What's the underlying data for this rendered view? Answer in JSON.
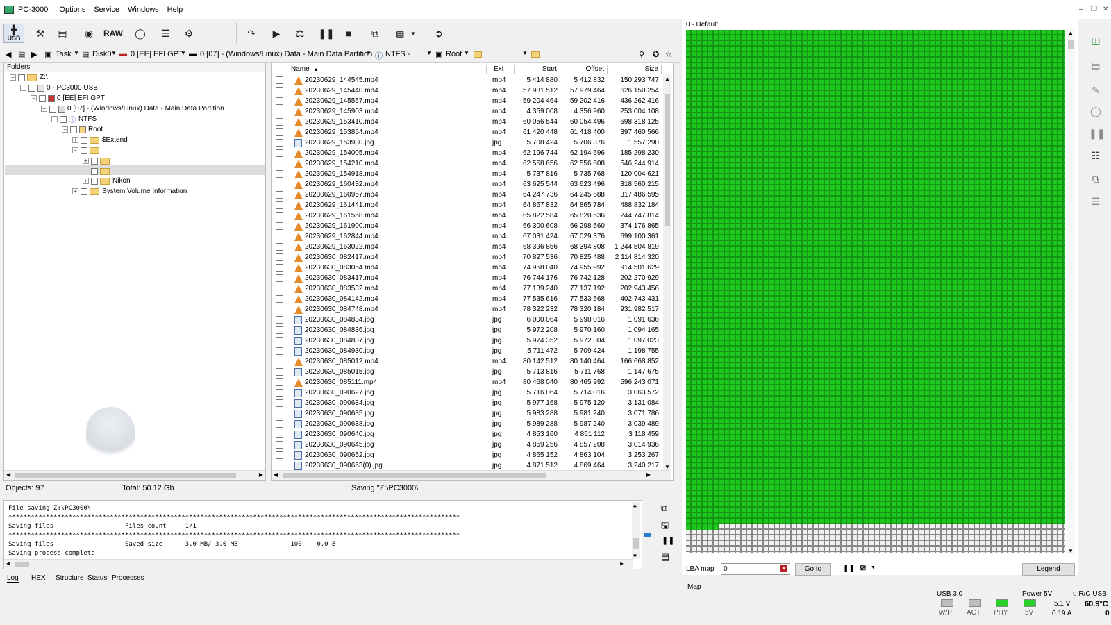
{
  "window": {
    "title": "PC-3000",
    "menu": [
      "Options",
      "Service",
      "Windows",
      "Help"
    ]
  },
  "toolbar": {
    "usb_label": "USB",
    "raw_label": "RAW"
  },
  "pathbar": {
    "task": "Task",
    "disk": "Disk0",
    "gpt": "0 [EE] EFI GPT",
    "partition": "0 [07] - (Windows/Linux) Data - Main Data Partition",
    "fs": "NTFS -",
    "root": "Root"
  },
  "folders": {
    "header": "Folders",
    "nodes": [
      {
        "label": "Z:\\",
        "level": 0
      },
      {
        "label": "0 - PC3000 USB",
        "level": 1
      },
      {
        "label": "0 [EE] EFI GPT",
        "level": 2
      },
      {
        "label": "0 [07] - (Windows/Linux) Data - Main Data Partition",
        "level": 3
      },
      {
        "label": "NTFS",
        "level": 4
      },
      {
        "label": "Root",
        "level": 5
      },
      {
        "label": "$Extend",
        "level": 6
      },
      {
        "label": "",
        "level": 6
      },
      {
        "label": "",
        "level": 7
      },
      {
        "label": "",
        "level": 7
      },
      {
        "label": "Nikon",
        "level": 7
      },
      {
        "label": "System Volume Information",
        "level": 6
      }
    ]
  },
  "files": {
    "columns": [
      "Name",
      "Ext",
      "Start",
      "Offset",
      "Size"
    ],
    "rows": [
      [
        "20230629_144545.mp4",
        "mp4",
        "5 414 880",
        "5 412 832",
        "150 293 747"
      ],
      [
        "20230629_145440.mp4",
        "mp4",
        "57 981 512",
        "57 979 464",
        "626 150 254"
      ],
      [
        "20230629_145557.mp4",
        "mp4",
        "59 204 464",
        "59 202 416",
        "436 262 416"
      ],
      [
        "20230629_145903.mp4",
        "mp4",
        "4 359 008",
        "4 356 960",
        "253 004 108"
      ],
      [
        "20230629_153410.mp4",
        "mp4",
        "60 056 544",
        "60 054 496",
        "698 318 125"
      ],
      [
        "20230629_153854.mp4",
        "mp4",
        "61 420 448",
        "61 418 400",
        "397 460 566"
      ],
      [
        "20230629_153930.jpg",
        "jpg",
        "5 708 424",
        "5 706 376",
        "1 557 290"
      ],
      [
        "20230629_154005.mp4",
        "mp4",
        "62 196 744",
        "62 194 696",
        "185 298 230"
      ],
      [
        "20230629_154210.mp4",
        "mp4",
        "62 558 656",
        "62 556 608",
        "546 244 914"
      ],
      [
        "20230629_154918.mp4",
        "mp4",
        "5 737 816",
        "5 735 768",
        "120 004 621"
      ],
      [
        "20230629_160432.mp4",
        "mp4",
        "63 625 544",
        "63 623 496",
        "318 560 215"
      ],
      [
        "20230629_160957.mp4",
        "mp4",
        "64 247 736",
        "64 245 688",
        "317 486 595"
      ],
      [
        "20230629_161441.mp4",
        "mp4",
        "64 867 832",
        "64 865 784",
        "488 832 184"
      ],
      [
        "20230629_161558.mp4",
        "mp4",
        "65 822 584",
        "65 820 536",
        "244 747 814"
      ],
      [
        "20230629_161900.mp4",
        "mp4",
        "66 300 608",
        "66 298 560",
        "374 176 865"
      ],
      [
        "20230629_162844.mp4",
        "mp4",
        "67 031 424",
        "67 029 376",
        "699 100 361"
      ],
      [
        "20230629_163022.mp4",
        "mp4",
        "68 396 856",
        "68 394 808",
        "1 244 504 819"
      ],
      [
        "20230630_082417.mp4",
        "mp4",
        "70 827 536",
        "70 825 488",
        "2 114 814 320"
      ],
      [
        "20230630_083054.mp4",
        "mp4",
        "74 958 040",
        "74 955 992",
        "914 501 629"
      ],
      [
        "20230630_083417.mp4",
        "mp4",
        "76 744 176",
        "76 742 128",
        "202 270 929"
      ],
      [
        "20230630_083532.mp4",
        "mp4",
        "77 139 240",
        "77 137 192",
        "202 943 456"
      ],
      [
        "20230630_084142.mp4",
        "mp4",
        "77 535 616",
        "77 533 568",
        "402 743 431"
      ],
      [
        "20230630_084748.mp4",
        "mp4",
        "78 322 232",
        "78 320 184",
        "931 982 517"
      ],
      [
        "20230630_084834.jpg",
        "jpg",
        "6 000 064",
        "5 998 016",
        "1 091 636"
      ],
      [
        "20230630_084836.jpg",
        "jpg",
        "5 972 208",
        "5 970 160",
        "1 094 165"
      ],
      [
        "20230630_084837.jpg",
        "jpg",
        "5 974 352",
        "5 972 304",
        "1 097 023"
      ],
      [
        "20230630_084930.jpg",
        "jpg",
        "5 711 472",
        "5 709 424",
        "1 198 755"
      ],
      [
        "20230630_085012.mp4",
        "mp4",
        "80 142 512",
        "80 140 464",
        "166 668 852"
      ],
      [
        "20230630_085015.jpg",
        "jpg",
        "5 713 816",
        "5 711 768",
        "1 147 675"
      ],
      [
        "20230630_085111.mp4",
        "mp4",
        "80 468 040",
        "80 465 992",
        "596 243 071"
      ],
      [
        "20230630_090627.jpg",
        "jpg",
        "5 716 064",
        "5 714 016",
        "3 063 572"
      ],
      [
        "20230630_090634.jpg",
        "jpg",
        "5 977 168",
        "5 975 120",
        "3 131 084"
      ],
      [
        "20230630_090635.jpg",
        "jpg",
        "5 983 288",
        "5 981 240",
        "3 071 786"
      ],
      [
        "20230630_090638.jpg",
        "jpg",
        "5 989 288",
        "5 987 240",
        "3 039 489"
      ],
      [
        "20230630_090640.jpg",
        "jpg",
        "4 853 160",
        "4 851 112",
        "3 118 459"
      ],
      [
        "20230630_090645.jpg",
        "jpg",
        "4 859 256",
        "4 857 208",
        "3 014 936"
      ],
      [
        "20230630_090652.jpg",
        "jpg",
        "4 865 152",
        "4 863 104",
        "3 253 267"
      ],
      [
        "20230630_090653(0).jpg",
        "jpg",
        "4 871 512",
        "4 869 464",
        "3 240 217"
      ]
    ]
  },
  "status": {
    "objects": "Objects: 97",
    "total": "Total: 50.12 Gb",
    "saving": "Saving  \"Z:\\PC3000\\"
  },
  "log": {
    "lines": [
      "File saving Z:\\PC3000\\",
      "************************************************************************************************************************",
      "Saving files                   Files count     1/1",
      "************************************************************************************************************************",
      "Saving files                   Saved size      3.0 MB/ 3.0 MB              100    0.0 B",
      "Saving process complete"
    ]
  },
  "bottom_tabs": [
    "Log",
    "HEX",
    "Structure",
    "Status",
    "Processes"
  ],
  "map": {
    "title": "0 - Default",
    "lba_label": "LBA map",
    "lba_value": "0",
    "goto_label": "Go to",
    "legend_label": "Legend",
    "tab": "Map"
  },
  "indicators": {
    "usb": "USB 3.0",
    "power": "Power 5V",
    "rc": "t, R/C USB",
    "wp": "W/P",
    "act": "ACT",
    "phy": "PHY",
    "v5": "5V",
    "volt": "5.1 V",
    "amp": "0.19 A",
    "temp": "60.9°C",
    "zero": "0"
  },
  "colors": {
    "map_green": "#1fc81f",
    "phy_led": "#2bd12b",
    "v5_led": "#2bd12b",
    "led_off": "#bdbdbd"
  }
}
